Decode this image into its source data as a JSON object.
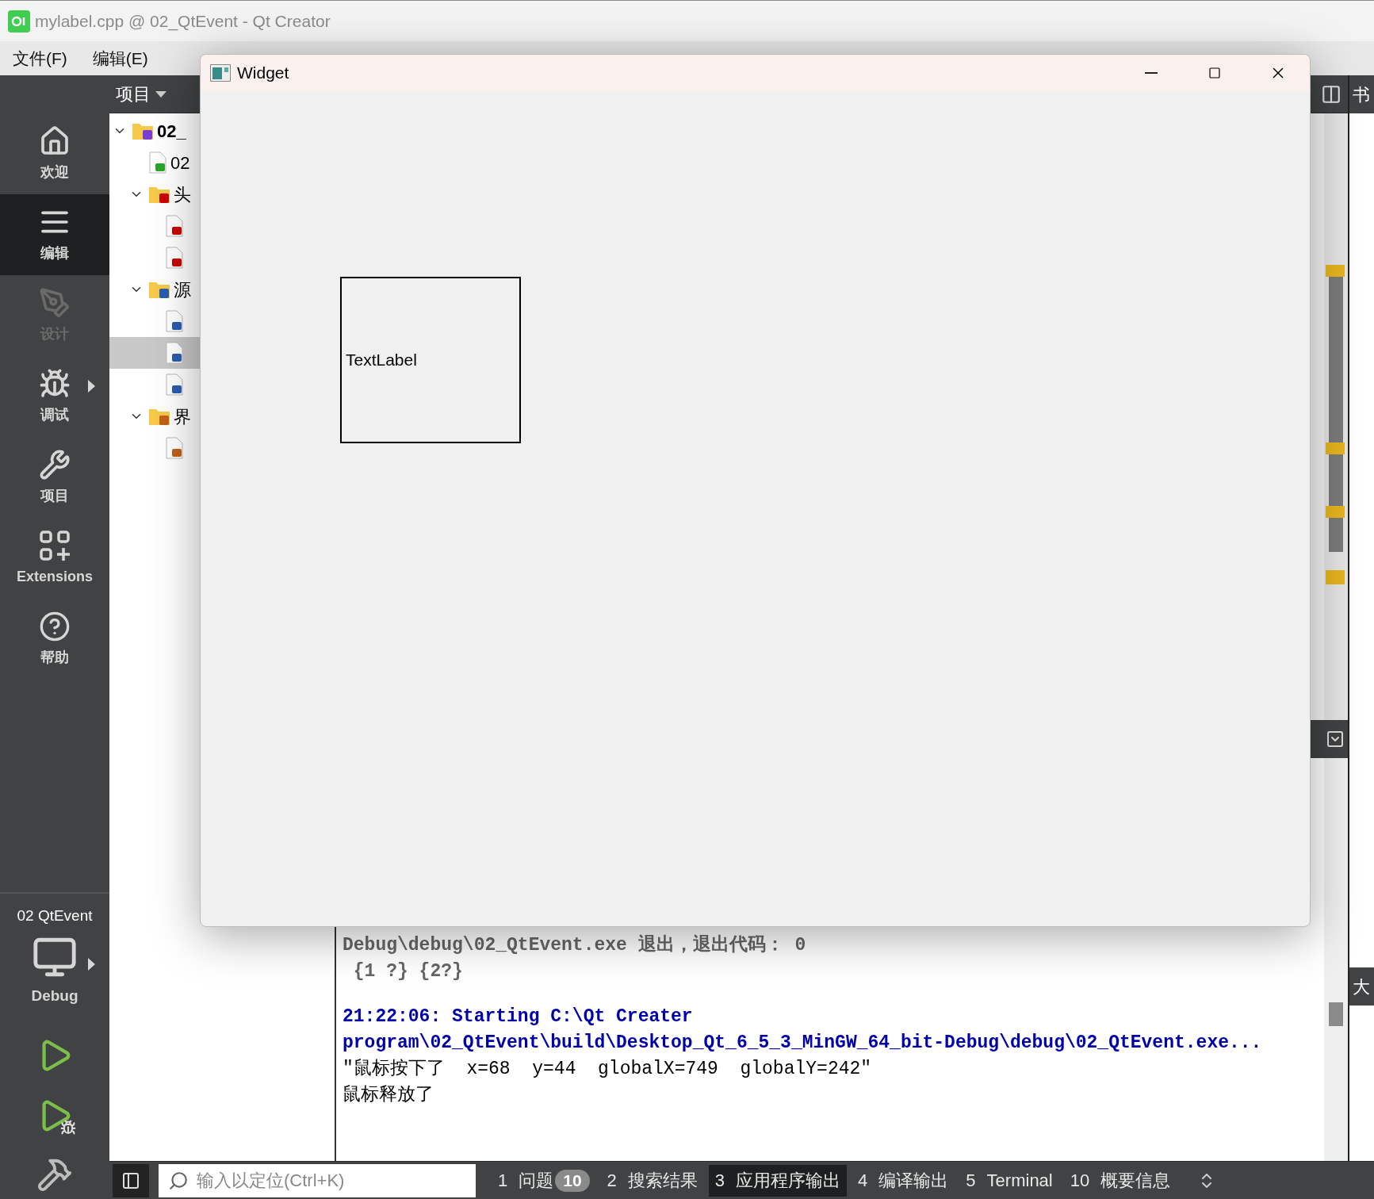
{
  "window": {
    "title": "mylabel.cpp @ 02_QtEvent - Qt Creator"
  },
  "menu": [
    "文件(F)",
    "编辑(E)"
  ],
  "modes": [
    {
      "kind": "home",
      "label": "欢迎",
      "selected": false,
      "disabled": false,
      "submenu": false
    },
    {
      "kind": "edit",
      "label": "编辑",
      "selected": true,
      "disabled": false,
      "submenu": false
    },
    {
      "kind": "design",
      "label": "设计",
      "selected": false,
      "disabled": true,
      "submenu": false
    },
    {
      "kind": "debug",
      "label": "调试",
      "selected": false,
      "disabled": false,
      "submenu": true
    },
    {
      "kind": "projects",
      "label": "项目",
      "selected": false,
      "disabled": false,
      "submenu": false
    },
    {
      "kind": "extensions",
      "label": "Extensions",
      "selected": false,
      "disabled": false,
      "submenu": false
    },
    {
      "kind": "help",
      "label": "帮助",
      "selected": false,
      "disabled": false,
      "submenu": false
    }
  ],
  "kit": {
    "project": "02 QtEvent",
    "config": "Debug"
  },
  "project_panel": {
    "title": "项目",
    "tree": [
      {
        "kind": "project",
        "label": "02_",
        "selected": false,
        "expanded": true,
        "children": [
          {
            "kind": "qt-file",
            "label": "02",
            "selected": false
          },
          {
            "kind": "header-folder",
            "label": "头",
            "selected": false,
            "expanded": true,
            "children": [
              {
                "kind": "header",
                "selected": false
              },
              {
                "kind": "header",
                "selected": false
              }
            ]
          },
          {
            "kind": "source-folder",
            "label": "源",
            "selected": false,
            "expanded": true,
            "children": [
              {
                "kind": "source",
                "selected": false
              },
              {
                "kind": "source",
                "selected": true
              },
              {
                "kind": "source",
                "selected": false
              }
            ]
          },
          {
            "kind": "form-folder",
            "label": "界",
            "selected": false,
            "expanded": true,
            "children": [
              {
                "kind": "form",
                "selected": false
              }
            ]
          }
        ]
      }
    ]
  },
  "side_panels": [
    "书",
    "大"
  ],
  "output": [
    {
      "kind": "info",
      "text": "Debug\\debug\\02_QtEvent.exe 退出，退出代码： 0"
    },
    {
      "kind": "info",
      "text": " {1 ?} {2?}"
    },
    {
      "kind": "start",
      "text": "21:22:06: Starting C:\\Qt Creater"
    },
    {
      "kind": "start-cont",
      "text": "program\\02_QtEvent\\build\\Desktop_Qt_6_5_3_MinGW_64_bit-Debug\\debug\\02_QtEvent.exe..."
    },
    {
      "kind": "stdout",
      "text": "\"鼠标按下了  x=68  y=44  globalX=749  globalY=242\""
    },
    {
      "kind": "stdout",
      "text": "鼠标释放了"
    }
  ],
  "locator": {
    "placeholder": "输入以定位(Ctrl+K)"
  },
  "output_tabs": [
    {
      "number": "1",
      "label": "问题",
      "badge": "10",
      "selected": false
    },
    {
      "number": "2",
      "label": "搜索结果",
      "selected": false
    },
    {
      "number": "3",
      "label": "应用程序输出",
      "selected": true
    },
    {
      "number": "4",
      "label": "编译输出",
      "selected": false
    },
    {
      "number": "5",
      "label": "Terminal",
      "selected": false
    },
    {
      "number": "10",
      "label": "概要信息",
      "selected": false
    }
  ],
  "app_window": {
    "title": "Widget",
    "label": "TextLabel"
  }
}
